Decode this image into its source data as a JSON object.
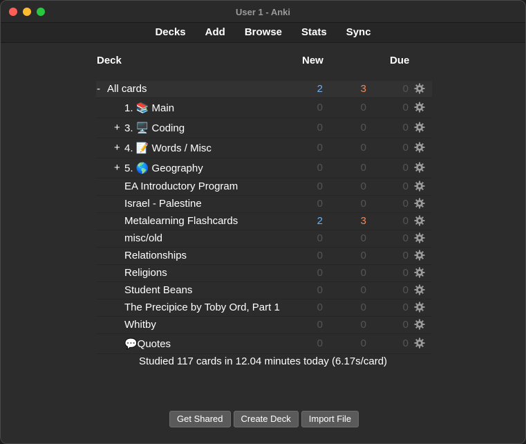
{
  "window": {
    "title": "User 1 - Anki"
  },
  "toolbar": {
    "items": [
      "Decks",
      "Add",
      "Browse",
      "Stats",
      "Sync"
    ]
  },
  "table": {
    "headers": {
      "deck": "Deck",
      "new": "New",
      "due": "Due"
    }
  },
  "decks": [
    {
      "toggle": "-",
      "label": "All cards",
      "new": "2",
      "learn": "3",
      "due": "0",
      "new_color": "#6ab0f3",
      "learn_color": "#f08a5d"
    },
    {
      "toggle": "",
      "label": "1. 📚 Main",
      "new": "0",
      "learn": "0",
      "due": "0"
    },
    {
      "toggle": "+",
      "label": "3. 🖥️ Coding",
      "new": "0",
      "learn": "0",
      "due": "0"
    },
    {
      "toggle": "+",
      "label": "4. 📝 Words / Misc",
      "new": "0",
      "learn": "0",
      "due": "0"
    },
    {
      "toggle": "+",
      "label": "5. 🌎 Geography",
      "new": "0",
      "learn": "0",
      "due": "0"
    },
    {
      "toggle": "",
      "label": "EA Introductory Program",
      "new": "0",
      "learn": "0",
      "due": "0"
    },
    {
      "toggle": "",
      "label": "Israel - Palestine",
      "new": "0",
      "learn": "0",
      "due": "0"
    },
    {
      "toggle": "",
      "label": "Metalearning Flashcards",
      "new": "2",
      "learn": "3",
      "due": "0",
      "new_color": "#6ab0f3",
      "learn_color": "#f08a5d"
    },
    {
      "toggle": "",
      "label": "misc/old",
      "new": "0",
      "learn": "0",
      "due": "0"
    },
    {
      "toggle": "",
      "label": "Relationships",
      "new": "0",
      "learn": "0",
      "due": "0"
    },
    {
      "toggle": "",
      "label": "Religions",
      "new": "0",
      "learn": "0",
      "due": "0"
    },
    {
      "toggle": "",
      "label": "Student Beans",
      "new": "0",
      "learn": "0",
      "due": "0"
    },
    {
      "toggle": "",
      "label": "The Precipice by Toby Ord, Part 1",
      "new": "0",
      "learn": "0",
      "due": "0"
    },
    {
      "toggle": "",
      "label": "Whitby",
      "new": "0",
      "learn": "0",
      "due": "0"
    },
    {
      "toggle": "",
      "label": "💬Quotes",
      "new": "0",
      "learn": "0",
      "due": "0"
    }
  ],
  "footer": {
    "studied": "Studied 117 cards in 12.04 minutes today (6.17s/card)",
    "buttons": [
      "Get Shared",
      "Create Deck",
      "Import File"
    ]
  }
}
